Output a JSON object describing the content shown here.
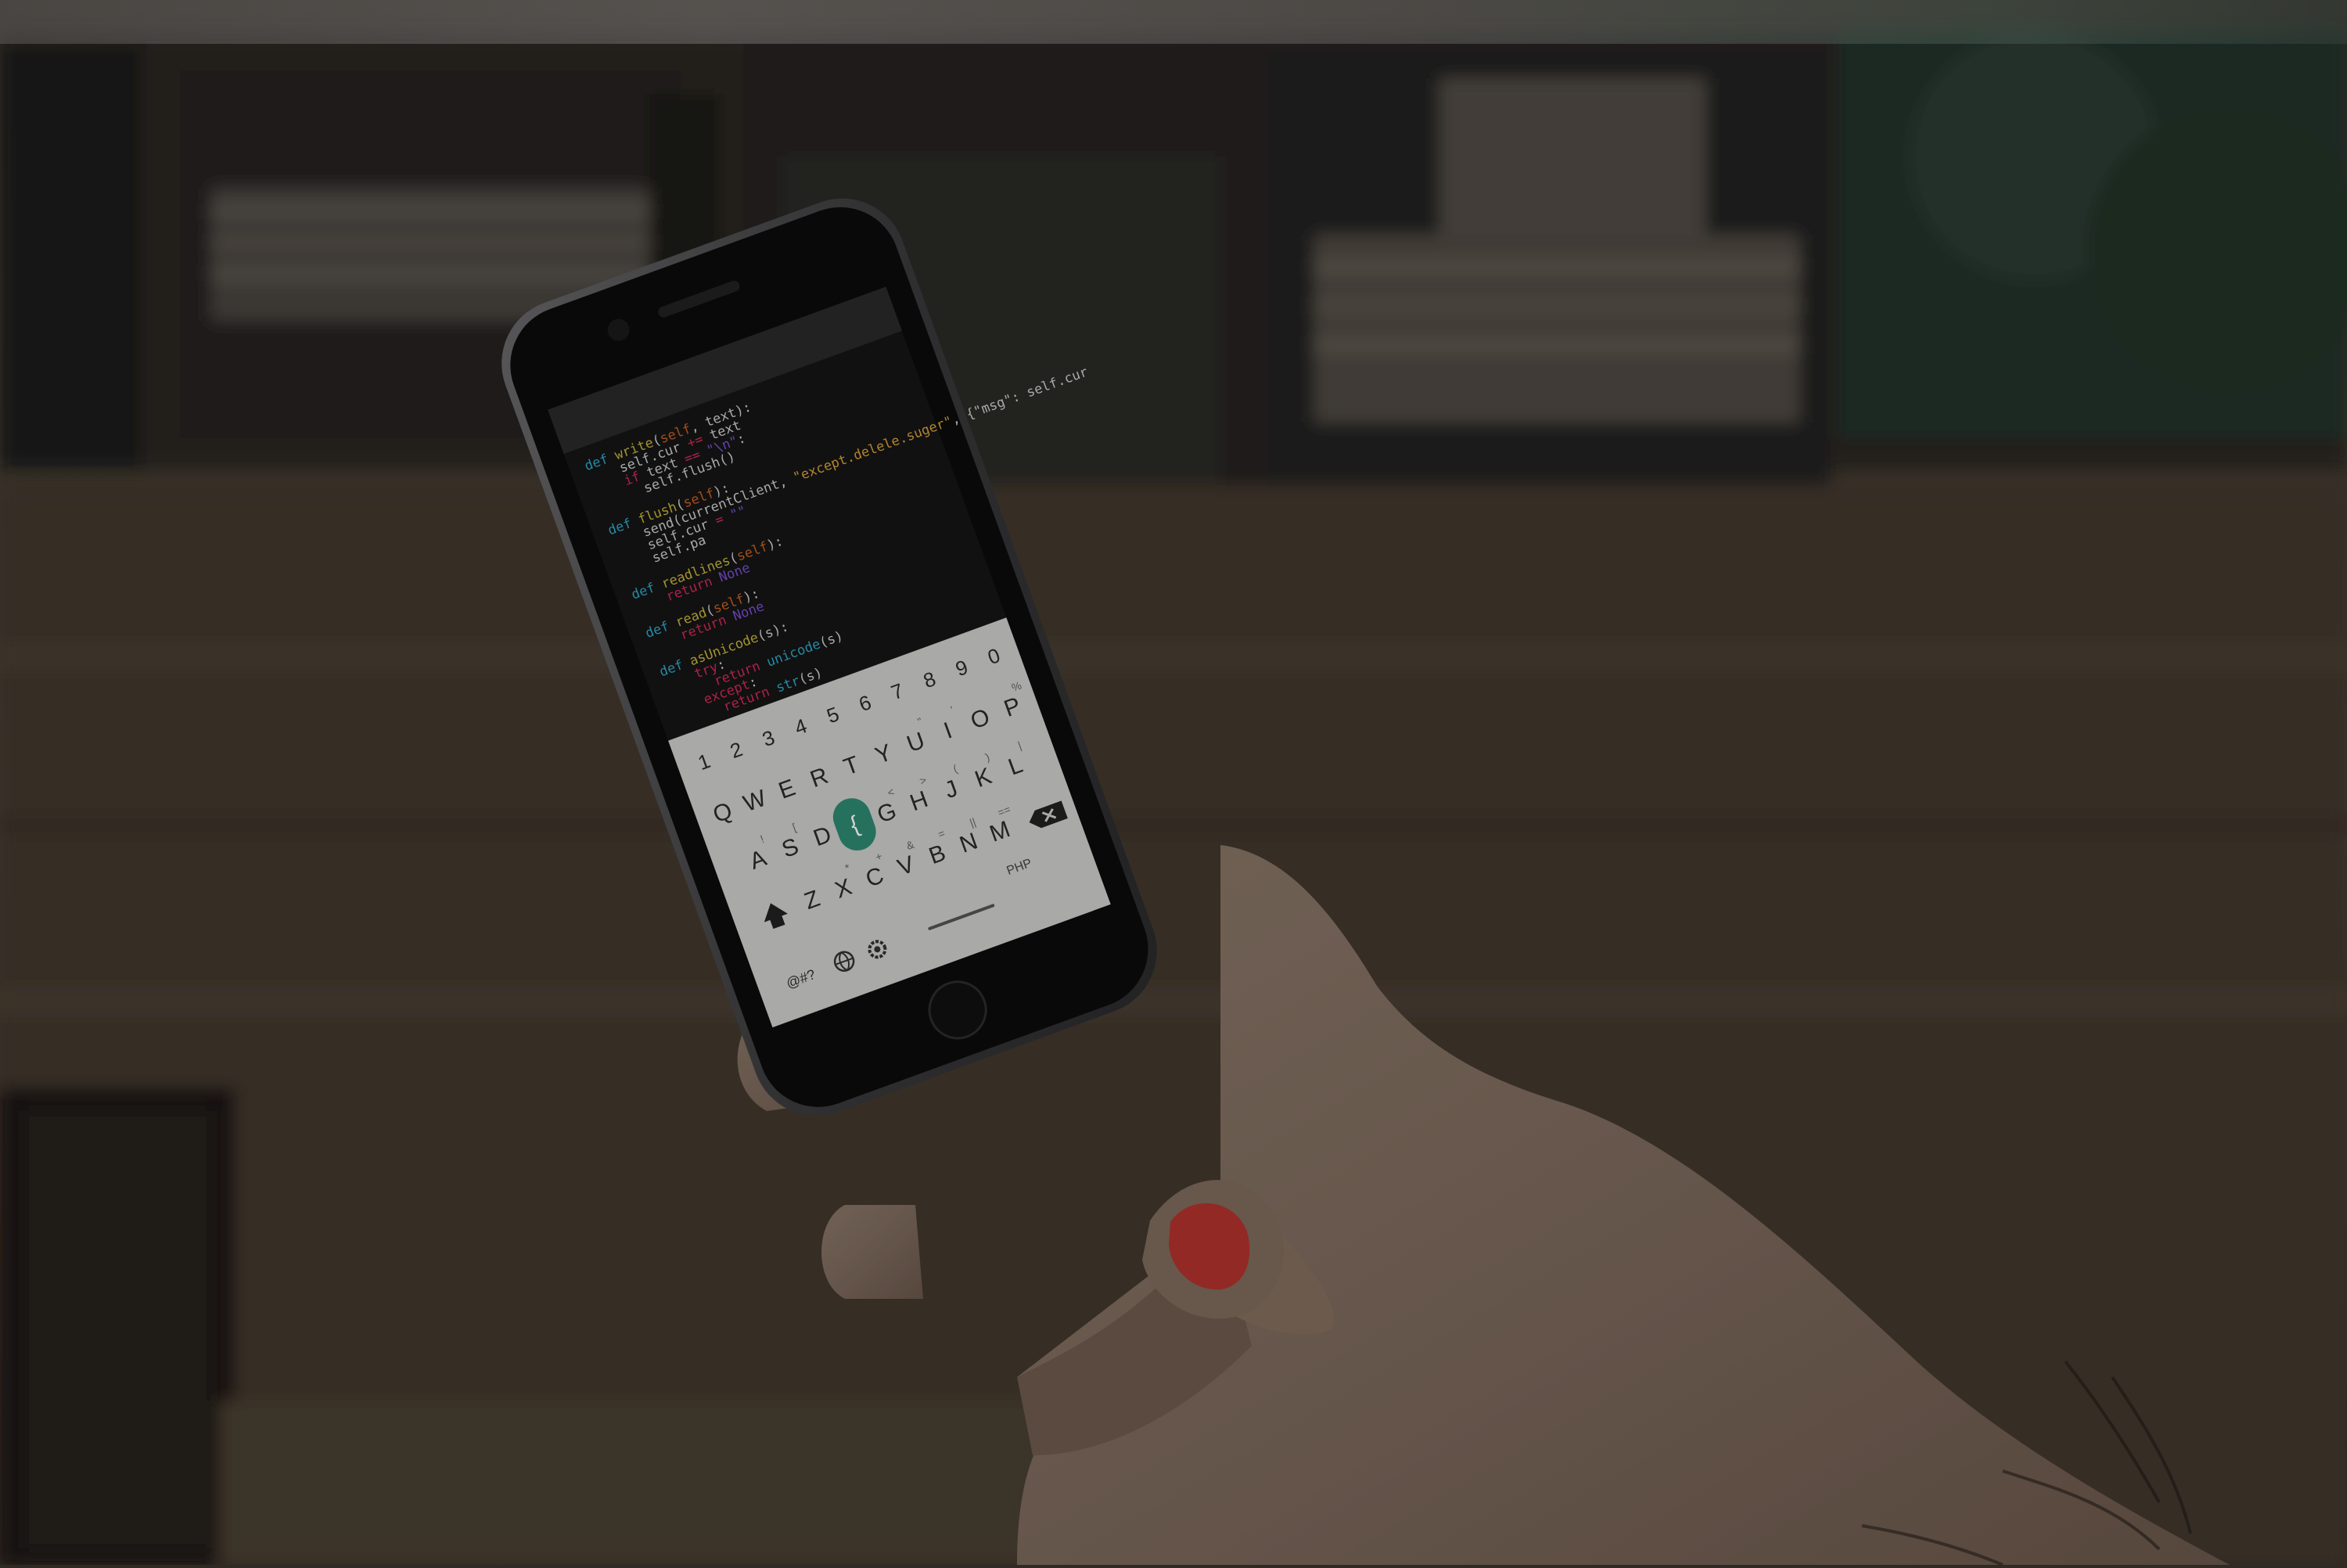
{
  "colors": {
    "code_bg": "#151515",
    "keyboard_bg": "#cfcfcd",
    "accent_key": "#2e8a72",
    "keyword": "#2ea8c8",
    "function": "#c8b43a",
    "string": "#d8a23a",
    "self": "#c86020",
    "literal": "#7a4fd0",
    "return": "#d02a5a",
    "operator": "#d02a5a",
    "nail": "#c23a34"
  },
  "code_lines": [
    [
      {
        "t": "def ",
        "c": "keyword"
      },
      {
        "t": "write",
        "c": "function"
      },
      {
        "t": "(",
        "c": "plain"
      },
      {
        "t": "self",
        "c": "self"
      },
      {
        "t": ", text):",
        "c": "plain"
      }
    ],
    [
      {
        "t": "    self.cur ",
        "c": "plain"
      },
      {
        "t": "+=",
        "c": "operator"
      },
      {
        "t": " text",
        "c": "plain"
      }
    ],
    [
      {
        "t": "    ",
        "c": "plain"
      },
      {
        "t": "if",
        "c": "return"
      },
      {
        "t": " text ",
        "c": "plain"
      },
      {
        "t": "==",
        "c": "operator"
      },
      {
        "t": " ",
        "c": "plain"
      },
      {
        "t": "\"\\n\"",
        "c": "literal"
      },
      {
        "t": ":",
        "c": "plain"
      }
    ],
    [
      {
        "t": "      self.flush()",
        "c": "plain"
      }
    ],
    [
      {
        "t": "",
        "c": "plain"
      }
    ],
    [
      {
        "t": "def ",
        "c": "keyword"
      },
      {
        "t": "flush",
        "c": "function"
      },
      {
        "t": "(",
        "c": "plain"
      },
      {
        "t": "self",
        "c": "self"
      },
      {
        "t": "):",
        "c": "plain"
      }
    ],
    [
      {
        "t": "    send(currentClient, ",
        "c": "plain"
      },
      {
        "t": "\"except.delele.suger\"",
        "c": "string"
      },
      {
        "t": ", {\"msg\": self.cur",
        "c": "plain"
      }
    ],
    [
      {
        "t": "    self.cur ",
        "c": "plain"
      },
      {
        "t": "=",
        "c": "operator"
      },
      {
        "t": " ",
        "c": "plain"
      },
      {
        "t": "\"\"",
        "c": "literal"
      }
    ],
    [
      {
        "t": "    self.pa",
        "c": "plain"
      }
    ],
    [
      {
        "t": "",
        "c": "plain"
      }
    ],
    [
      {
        "t": "def ",
        "c": "keyword"
      },
      {
        "t": "readlines",
        "c": "function"
      },
      {
        "t": "(",
        "c": "plain"
      },
      {
        "t": "self",
        "c": "self"
      },
      {
        "t": "):",
        "c": "plain"
      }
    ],
    [
      {
        "t": "    ",
        "c": "plain"
      },
      {
        "t": "return",
        "c": "return"
      },
      {
        "t": " ",
        "c": "plain"
      },
      {
        "t": "None",
        "c": "literal"
      }
    ],
    [
      {
        "t": "",
        "c": "plain"
      }
    ],
    [
      {
        "t": "def ",
        "c": "keyword"
      },
      {
        "t": "read",
        "c": "function"
      },
      {
        "t": "(",
        "c": "plain"
      },
      {
        "t": "self",
        "c": "self"
      },
      {
        "t": "):",
        "c": "plain"
      }
    ],
    [
      {
        "t": "    ",
        "c": "plain"
      },
      {
        "t": "return",
        "c": "return"
      },
      {
        "t": " ",
        "c": "plain"
      },
      {
        "t": "None",
        "c": "literal"
      }
    ],
    [
      {
        "t": "",
        "c": "plain"
      }
    ],
    [
      {
        "t": "def ",
        "c": "keyword"
      },
      {
        "t": "asUnicode",
        "c": "function"
      },
      {
        "t": "(s):",
        "c": "plain"
      }
    ],
    [
      {
        "t": "    ",
        "c": "plain"
      },
      {
        "t": "try",
        "c": "return"
      },
      {
        "t": ":",
        "c": "plain"
      }
    ],
    [
      {
        "t": "      ",
        "c": "plain"
      },
      {
        "t": "return",
        "c": "return"
      },
      {
        "t": " ",
        "c": "plain"
      },
      {
        "t": "unicode",
        "c": "keyword"
      },
      {
        "t": "(s)",
        "c": "plain"
      }
    ],
    [
      {
        "t": "    ",
        "c": "plain"
      },
      {
        "t": "except",
        "c": "return"
      },
      {
        "t": ":",
        "c": "plain"
      }
    ],
    [
      {
        "t": "      ",
        "c": "plain"
      },
      {
        "t": "return",
        "c": "return"
      },
      {
        "t": " ",
        "c": "plain"
      },
      {
        "t": "str",
        "c": "keyword"
      },
      {
        "t": "(s)",
        "c": "plain"
      }
    ]
  ],
  "keyboard": {
    "number_row": [
      "1",
      "2",
      "3",
      "4",
      "5",
      "6",
      "7",
      "8",
      "9",
      "0"
    ],
    "row1": [
      "Q",
      "W",
      "E",
      "R",
      "T",
      "Y",
      "U",
      "I",
      "O",
      "P"
    ],
    "row2": [
      "A",
      "S",
      "D",
      "{",
      "G",
      "H",
      "J",
      "K",
      "L"
    ],
    "row3": [
      "Z",
      "X",
      "C",
      "V",
      "B",
      "N",
      "M"
    ],
    "row1_hints": [
      "",
      "",
      "",
      "",
      "",
      "",
      "\"",
      "'",
      "",
      "%"
    ],
    "row2_hints": [
      "!",
      "[",
      "",
      "",
      "<",
      ">",
      "(",
      ")",
      "|"
    ],
    "row3_hints": [
      "",
      "*",
      "+",
      "&",
      "=",
      "||",
      "==",
      "\\"
    ],
    "active_key": "{",
    "symbols_label": "@#?",
    "language_label": "PHP",
    "shift_icon": "shift-icon",
    "backspace_icon": "backspace-icon",
    "globe_icon": "globe-icon",
    "settings_icon": "settings-icon"
  }
}
